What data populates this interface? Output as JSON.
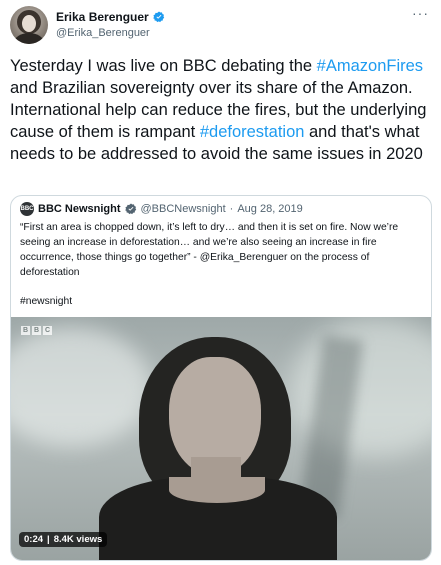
{
  "author": {
    "display_name": "Erika Berenguer",
    "handle": "@Erika_Berenguer",
    "verified_icon": "verified-badge-icon"
  },
  "more_icon": "more-options-icon",
  "tweet": {
    "segments": [
      "Yesterday I was live on BBC debating the ",
      "#AmazonFires",
      " and Brazilian sovereignty over its share of the Amazon. International help can reduce the fires, but the underlying cause of them is rampant ",
      "#deforestation",
      " and that's what needs to be addressed to avoid the same issues in 2020"
    ]
  },
  "quote": {
    "display_name": "BBC Newsnight",
    "handle": "@BBCNewsnight",
    "separator": "·",
    "date": "Aug 28, 2019",
    "text": "“First an area is chopped down, it’s left to dry… and then it is set on fire. Now we’re seeing an increase in deforestation… and we’re also seeing an increase in fire occurrence, those things go together” - @Erika_Berenguer on the process of deforestation",
    "hashtag": "#newsnight"
  },
  "video": {
    "logo_letters": [
      "B",
      "B",
      "C"
    ],
    "duration": "0:24",
    "separator": "|",
    "views": "8.4K views"
  },
  "colors": {
    "hashtag": "#1d9bf0",
    "verified": "#1d9bf0",
    "text": "#0f1419",
    "muted": "#536471"
  }
}
